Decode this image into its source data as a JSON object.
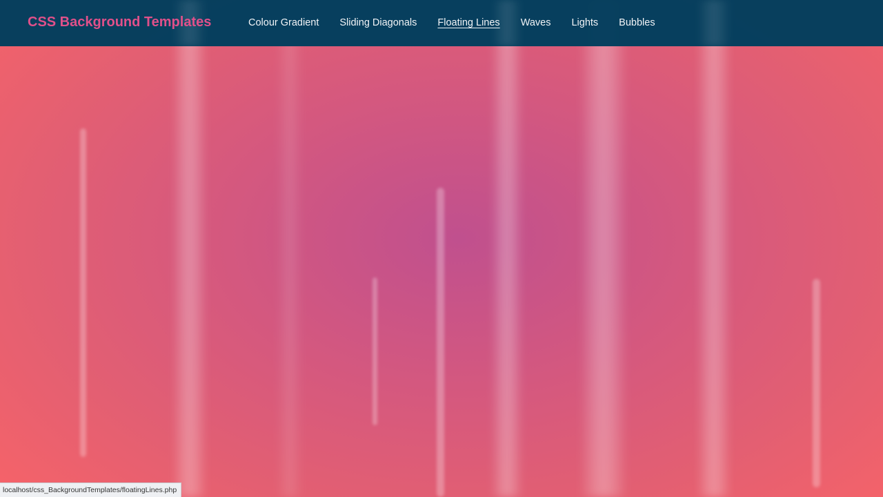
{
  "brand": {
    "title": "CSS Background Templates"
  },
  "nav": {
    "items": [
      {
        "label": "Colour Gradient",
        "active": false
      },
      {
        "label": "Sliding Diagonals",
        "active": false
      },
      {
        "label": "Floating Lines",
        "active": true
      },
      {
        "label": "Waves",
        "active": false
      },
      {
        "label": "Lights",
        "active": false
      },
      {
        "label": "Bubbles",
        "active": false
      }
    ]
  },
  "status_bar": {
    "url": "localhost/css_BackgroundTemplates/floatingLines.php"
  },
  "colors": {
    "navbar": "#003e5d",
    "brand": "#e0508a",
    "background_center": "#c0508e",
    "background_edge": "#fb6466"
  }
}
